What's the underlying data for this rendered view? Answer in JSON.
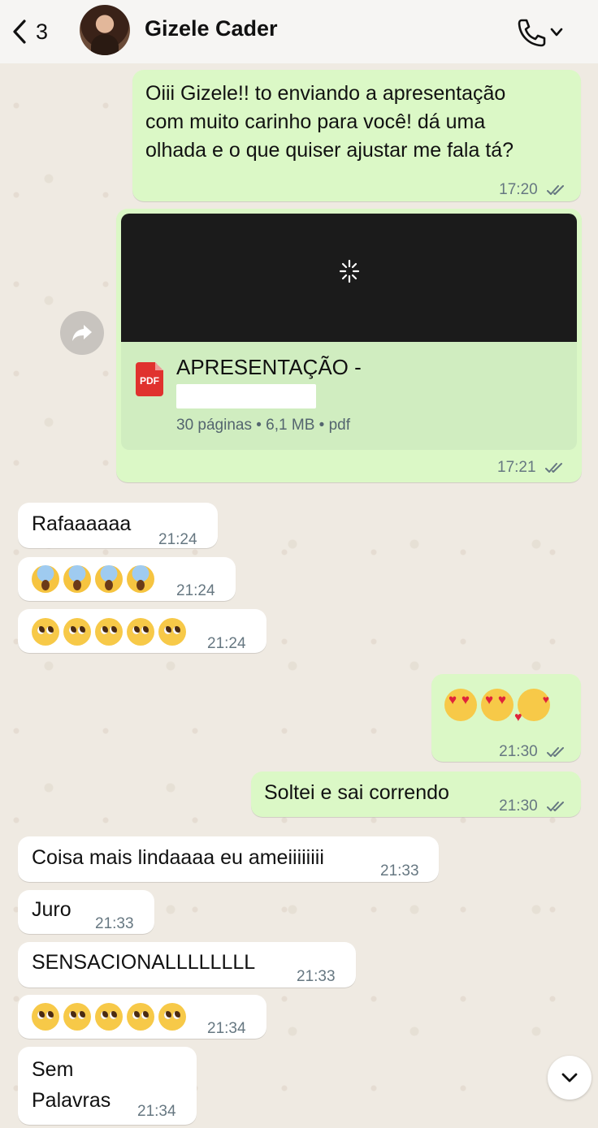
{
  "header": {
    "back_count": "3",
    "contact_name": "Gizele Cader"
  },
  "messages": [
    {
      "dir": "out",
      "text": "Oiii Gizele!! to enviando a apresentação\ncom muito carinho para você! dá uma\nolhada e o que quiser ajustar me fala tá?",
      "time": "17:20",
      "status": "read"
    },
    {
      "dir": "out",
      "type": "document",
      "title": "APRESENTAÇÃO -",
      "meta": "30 páginas • 6,1 MB • pdf",
      "file_type": "PDF",
      "time": "17:21",
      "status": "read"
    },
    {
      "dir": "in",
      "text": "Rafaaaaaa",
      "time": "21:24"
    },
    {
      "dir": "in",
      "emoji": [
        "😱",
        "😱",
        "😱",
        "😱"
      ],
      "time": "21:24"
    },
    {
      "dir": "in",
      "emoji": [
        "🥺",
        "🥺",
        "🥺",
        "🥺",
        "🥺"
      ],
      "time": "21:24"
    },
    {
      "dir": "out",
      "emoji": [
        "😍",
        "😍",
        "🥰"
      ],
      "time": "21:30",
      "status": "read"
    },
    {
      "dir": "out",
      "text": "Soltei e sai correndo",
      "time": "21:30",
      "status": "read"
    },
    {
      "dir": "in",
      "text": "Coisa mais lindaaaa eu ameiiiiiiii",
      "time": "21:33"
    },
    {
      "dir": "in",
      "text": "Juro",
      "time": "21:33"
    },
    {
      "dir": "in",
      "text": "SENSACIONALLLLLLLL",
      "time": "21:33"
    },
    {
      "dir": "in",
      "emoji": [
        "🥺",
        "🥺",
        "🥺",
        "🥺",
        "🥺"
      ],
      "time": "21:34"
    },
    {
      "dir": "in",
      "text": "Sem\nPalavras",
      "time": "21:34"
    }
  ],
  "icons": {
    "back": "chevron-left-icon",
    "call": "phone-icon",
    "forward": "forward-icon",
    "scroll": "chevron-down-icon",
    "read_receipt": "double-check-icon",
    "loading": "spinner-icon"
  },
  "colors": {
    "outgoing_bubble": "#dbf8c6",
    "incoming_bubble": "#ffffff",
    "document_strip": "#d0edc0",
    "pdf_red": "#e0322e",
    "wallpaper": "#efeae2",
    "timestamp": "#667781"
  }
}
